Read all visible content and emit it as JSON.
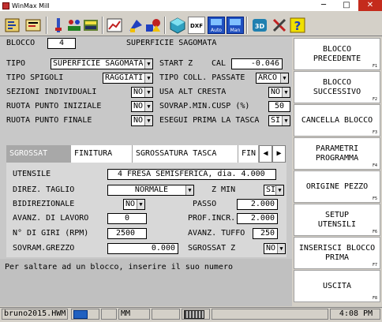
{
  "window": {
    "title": "WinMax Mill",
    "min": "─",
    "max": "□",
    "close": "✕"
  },
  "toolbar": {
    "icons": [
      "edit-icon",
      "list-icon",
      "tool-icon",
      "gauge-icon",
      "graph-icon",
      "paint-icon",
      "shapes-icon",
      "sphere-icon",
      "dxf-icon",
      "auto-icon",
      "man-icon",
      "3d-icon",
      "tools-x-icon",
      "help-icon"
    ],
    "dxf_label": "DXF",
    "auto_label": "Auto",
    "man_label": "Man",
    "threed_label": "3D"
  },
  "form": {
    "blocco_label": "BLOCCO",
    "blocco_value": "4",
    "block_title": "SUPERFICIE SAGOMATA",
    "tipo_label": "TIPO",
    "tipo_value": "SUPERFICIE SAGOMATA",
    "start_z_label": "START Z",
    "cal_label": "CAL",
    "start_z_value": "-0.046",
    "tipo_spigoli_label": "TIPO SPIGOLI",
    "tipo_spigoli_value": "RAGGIATI",
    "tipo_coll_label": "TIPO COLL. PASSATE",
    "tipo_coll_value": "ARCO",
    "sezioni_label": "SEZIONI INDIVIDUALI",
    "sezioni_value": "NO",
    "usa_alt_label": "USA ALT CRESTA",
    "usa_alt_value": "NO",
    "ruota_iniziale_label": "RUOTA PUNTO INIZIALE",
    "ruota_iniziale_value": "NO",
    "sovrap_label": "SOVRAP.MIN.CUSP (%)",
    "sovrap_value": "50",
    "ruota_finale_label": "RUOTA PUNTO FINALE",
    "ruota_finale_value": "NO",
    "esegui_label": "ESEGUI PRIMA LA TASCA",
    "esegui_value": "SI"
  },
  "tabs": [
    {
      "label": "SGROSSAT",
      "active": true
    },
    {
      "label": "FINITURA",
      "active": false
    },
    {
      "label": "SGROSSATURA TASCA",
      "active": false
    },
    {
      "label": "FIN",
      "active": false
    }
  ],
  "tab_nav": {
    "prev": "◀",
    "next": "▶"
  },
  "sgrossat": {
    "utensile_label": "UTENSILE",
    "utensile_value": "4 FRESA SEMISFERICA, dia. 4.000",
    "direz_label": "DIREZ. TAGLIO",
    "direz_value": "NORMALE",
    "zmin_label": "Z MIN",
    "zmin_value": "SI",
    "bidir_label": "BIDIREZIONALE",
    "bidir_value": "NO",
    "passo_label": "PASSO",
    "passo_value": "2.000",
    "avanz_label": "AVANZ. DI LAVORO",
    "avanz_value": "0",
    "prof_label": "PROF.INCR.",
    "prof_value": "2.000",
    "giri_label": "N° DI GIRI (RPM)",
    "giri_value": "2500",
    "tuffo_label": "AVANZ. TUFFO",
    "tuffo_value": "250",
    "sovram_label": "SOVRAM.GREZZO",
    "sovram_value": "0.000",
    "sgrossat_z_label": "SGROSSAT Z",
    "sgrossat_z_value": "NO"
  },
  "message": "Per saltare ad un blocco, inserire il suo numero",
  "side_buttons": [
    {
      "label": "BLOCCO\nPRECEDENTE",
      "key": "F1"
    },
    {
      "label": "BLOCCO\nSUCCESSIVO",
      "key": "F2"
    },
    {
      "label": "CANCELLA BLOCCO",
      "key": "F3"
    },
    {
      "label": "PARAMETRI\nPROGRAMMA",
      "key": "F4"
    },
    {
      "label": "ORIGINE PEZZO",
      "key": "F5"
    },
    {
      "label": "SETUP\nUTENSILI",
      "key": "F6"
    },
    {
      "label": "INSERISCI BLOCCO\nPRIMA",
      "key": "F7"
    },
    {
      "label": "USCITA",
      "key": "F8"
    }
  ],
  "status": {
    "file": "bruno2015.HWM",
    "mode": "MM",
    "time": "4:08 PM"
  },
  "colors": {
    "close_button": "#c42b1c",
    "active_tab": "#a8a8a8"
  }
}
